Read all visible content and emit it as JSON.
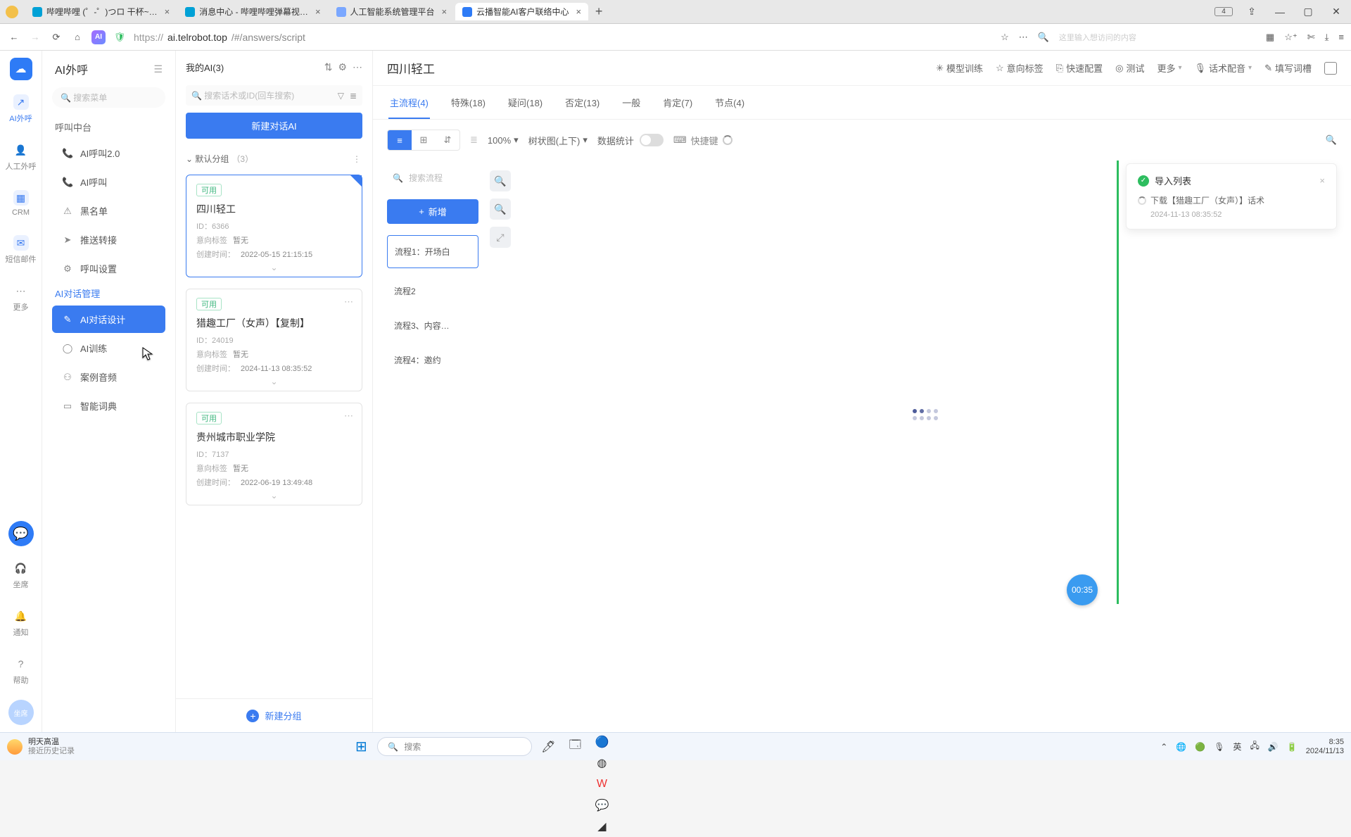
{
  "browser": {
    "tabs": [
      {
        "title": "哔哩哔哩 (゜-゜)つロ 干杯~…",
        "fav_bg": "#00a1d6"
      },
      {
        "title": "消息中心 - 哔哩哔哩弹幕视…",
        "fav_bg": "#00a1d6"
      },
      {
        "title": "人工智能系统管理平台",
        "fav_bg": "#3a7bf0"
      },
      {
        "title": "云播智能AI客户联络中心",
        "fav_bg": "#2e7bf6",
        "active": true
      }
    ],
    "url_proto": "https://",
    "url_host": "ai.telrobot.top",
    "url_path": "/#/answers/script",
    "search_placeholder": "这里输入想访问的内容",
    "win_badge": "4"
  },
  "rail": {
    "items": [
      {
        "icon": "↗",
        "label": "AI外呼",
        "accent": true,
        "blue": true
      },
      {
        "icon": "👤",
        "label": "人工外呼"
      },
      {
        "icon": "▦",
        "label": "CRM",
        "accent": true
      },
      {
        "icon": "✉",
        "label": "短信邮件",
        "accent": true
      },
      {
        "icon": "⋯",
        "label": "更多"
      }
    ],
    "bottom": [
      {
        "icon": "🎧",
        "label": "坐席"
      },
      {
        "icon": "🔔",
        "label": "通知"
      },
      {
        "icon": "?",
        "label": "帮助"
      }
    ],
    "avatar": "坐席"
  },
  "sidebar": {
    "title": "AI外呼",
    "search_placeholder": "搜索菜单",
    "groups": [
      {
        "header": "呼叫中台",
        "items": [
          {
            "icon": "📞",
            "label": "AI呼叫2.0"
          },
          {
            "icon": "📞",
            "label": "AI呼叫"
          },
          {
            "icon": "⚠",
            "label": "黑名单"
          },
          {
            "icon": "➤",
            "label": "推送转接"
          },
          {
            "icon": "⚙",
            "label": "呼叫设置"
          }
        ]
      },
      {
        "header": "AI对话管理",
        "blue": true,
        "items": [
          {
            "icon": "✎",
            "label": "AI对话设计",
            "active": true
          },
          {
            "icon": "◯",
            "label": "AI训练"
          },
          {
            "icon": "⚇",
            "label": "案例音频"
          },
          {
            "icon": "▭",
            "label": "智能词典"
          }
        ]
      }
    ]
  },
  "ai_panel": {
    "header": "我的AI(3)",
    "search_placeholder": "搜索话术或ID(回车搜索)",
    "new_btn": "新建对话AI",
    "group_label": "默认分组",
    "group_count": "（3）",
    "cards": [
      {
        "badge": "可用",
        "title": "四川轻工",
        "id": "ID：6366",
        "intent_lbl": "意向标签",
        "intent_val": "暂无",
        "time_lbl": "创建时间：",
        "time_val": "2022-05-15 21:15:15",
        "selected": true,
        "flag": true
      },
      {
        "badge": "可用",
        "title": "猎趣工厂（女声）【复制】",
        "id": "ID：24019",
        "intent_lbl": "意向标签",
        "intent_val": "暂无",
        "time_lbl": "创建时间：",
        "time_val": "2024-11-13 08:35:52"
      },
      {
        "badge": "可用",
        "title": "贵州城市职业学院",
        "id": "ID：7137",
        "intent_lbl": "意向标签",
        "intent_val": "暂无",
        "time_lbl": "创建时间：",
        "time_val": "2022-06-19 13:49:48"
      }
    ],
    "footer": "新建分组"
  },
  "main": {
    "title": "四川轻工",
    "actions": [
      {
        "icon": "✳",
        "label": "模型训练"
      },
      {
        "icon": "☆",
        "label": "意向标签"
      },
      {
        "icon": "⎘",
        "label": "快速配置"
      },
      {
        "icon": "◎",
        "label": "测试"
      },
      {
        "label": "更多",
        "caret": true
      },
      {
        "icon": "🎙",
        "label": "话术配音",
        "caret": true
      },
      {
        "icon": "✎",
        "label": "填写词槽"
      }
    ],
    "tabs": [
      {
        "label": "主流程(4)",
        "active": true
      },
      {
        "label": "特殊(18)"
      },
      {
        "label": "疑问(18)"
      },
      {
        "label": "否定(13)"
      },
      {
        "label": "一般"
      },
      {
        "label": "肯定(7)"
      },
      {
        "label": "节点(4)"
      }
    ],
    "toolbar": {
      "zoom": "100%",
      "tree": "树状图(上下)",
      "stat": "数据统计",
      "shortcut": "快捷键"
    },
    "flow": {
      "search_placeholder": "搜索流程",
      "add": "新增",
      "nodes": [
        {
          "label": "流程1：开场白",
          "sel": true
        },
        {
          "label": "流程2"
        },
        {
          "label": "流程3、内容…"
        },
        {
          "label": "流程4：邀约"
        }
      ]
    },
    "timer": "00:35",
    "toast": {
      "title": "导入列表",
      "line": "下载【猎趣工厂（女声）】话术",
      "ts": "2024-11-13 08:35:52"
    }
  },
  "taskbar": {
    "weather_l1": "明天高温",
    "weather_l2": "接近历史记录",
    "search": "搜索",
    "ime": "英",
    "time": "8:35",
    "date": "2024/11/13"
  }
}
